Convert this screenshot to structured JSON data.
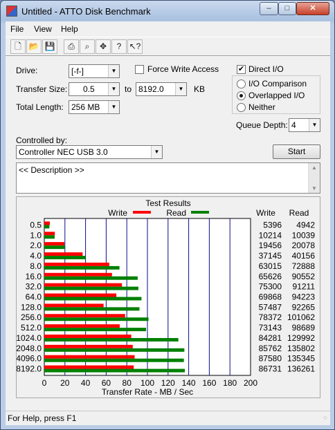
{
  "window": {
    "title": "Untitled - ATTO Disk Benchmark",
    "app_icon": "atto-app-icon"
  },
  "menu": [
    "File",
    "View",
    "Help"
  ],
  "toolbar": [
    "new-icon",
    "open-icon",
    "save-icon",
    "print-icon",
    "print-preview-icon",
    "move-icon",
    "help-icon",
    "context-help-icon"
  ],
  "settings": {
    "drive_label": "Drive:",
    "drive_value": "[-f-]",
    "force_write_label": "Force Write Access",
    "force_write_checked": false,
    "direct_io_label": "Direct I/O",
    "direct_io_checked": true,
    "transfer_size_label": "Transfer Size:",
    "transfer_from": "0.5",
    "to_label": "to",
    "transfer_to": "8192.0",
    "kb_label": "KB",
    "total_length_label": "Total Length:",
    "total_length_value": "256 MB",
    "io_options": [
      {
        "label": "I/O Comparison",
        "selected": false
      },
      {
        "label": "Overlapped I/O",
        "selected": true
      },
      {
        "label": "Neither",
        "selected": false
      }
    ],
    "queue_depth_label": "Queue Depth:",
    "queue_depth_value": "4",
    "controlled_by_label": "Controlled by:",
    "controlled_by_value": "Controller NEC USB 3.0",
    "start_label": "Start",
    "description": "<< Description >>"
  },
  "results": {
    "title": "Test Results",
    "write_legend": "Write",
    "read_legend": "Read",
    "write_col": "Write",
    "read_col": "Read",
    "x_axis_label": "Transfer Rate - MB / Sec",
    "write_color": "#ff0000",
    "read_color": "#008000"
  },
  "chart_data": {
    "type": "bar",
    "orientation": "horizontal",
    "title": "Test Results",
    "xlabel": "Transfer Rate - MB / Sec",
    "xlim": [
      0,
      200
    ],
    "xticks": [
      0,
      20,
      40,
      60,
      80,
      100,
      120,
      140,
      160,
      180,
      200
    ],
    "categories": [
      "0.5",
      "1.0",
      "2.0",
      "4.0",
      "8.0",
      "16.0",
      "32.0",
      "64.0",
      "128.0",
      "256.0",
      "512.0",
      "1024.0",
      "2048.0",
      "4096.0",
      "8192.0"
    ],
    "series": [
      {
        "name": "Write",
        "color": "#ff0000",
        "values": [
          5.396,
          10.214,
          19.456,
          37.145,
          63.015,
          65.626,
          75.3,
          69.868,
          57.487,
          78.372,
          73.143,
          84.281,
          85.762,
          87.58,
          86.731
        ]
      },
      {
        "name": "Read",
        "color": "#008000",
        "values": [
          4.942,
          10.039,
          20.078,
          40.156,
          72.888,
          90.552,
          91.211,
          94.223,
          92.265,
          101.062,
          98.689,
          129.992,
          135.802,
          135.345,
          136.261
        ]
      }
    ],
    "write_numbers": [
      "5396",
      "10214",
      "19456",
      "37145",
      "63015",
      "65626",
      "75300",
      "69868",
      "57487",
      "78372",
      "73143",
      "84281",
      "85762",
      "87580",
      "86731"
    ],
    "read_numbers": [
      "4942",
      "10039",
      "20078",
      "40156",
      "72888",
      "90552",
      "91211",
      "94223",
      "92265",
      "101062",
      "98689",
      "129992",
      "135802",
      "135345",
      "136261"
    ]
  },
  "status": {
    "text": "For Help, press F1"
  }
}
